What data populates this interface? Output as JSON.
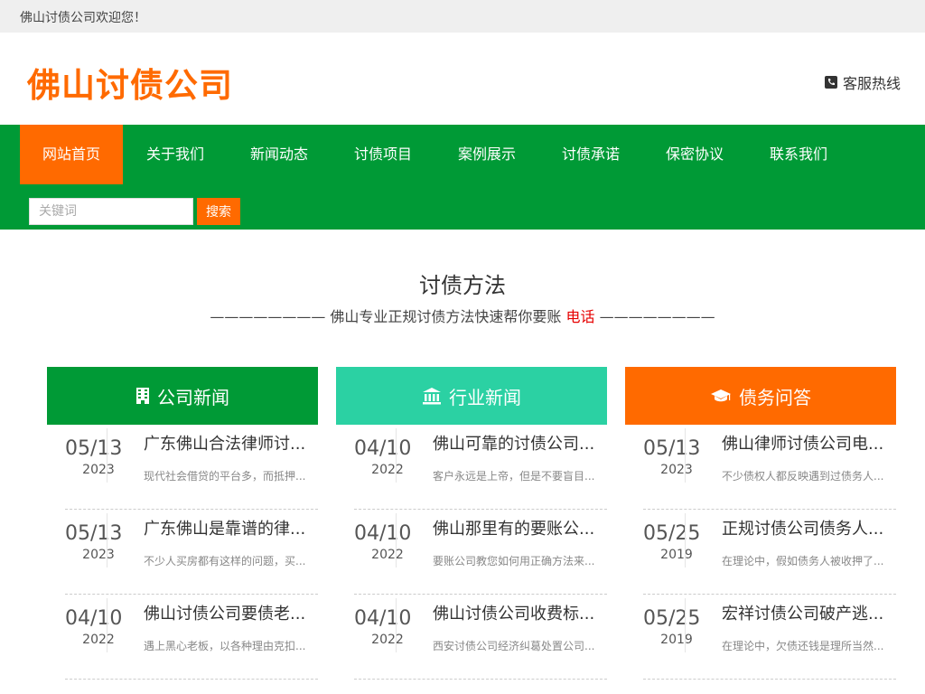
{
  "topbar": {
    "welcome": "佛山讨债公司欢迎您！"
  },
  "header": {
    "logo": "佛山讨债公司",
    "hotline": "客服热线"
  },
  "nav": {
    "items": [
      {
        "label": "网站首页"
      },
      {
        "label": "关于我们"
      },
      {
        "label": "新闻动态"
      },
      {
        "label": "讨债项目"
      },
      {
        "label": "案例展示"
      },
      {
        "label": "讨债承诺"
      },
      {
        "label": "保密协议"
      },
      {
        "label": "联系我们"
      }
    ],
    "search_placeholder": "关键词",
    "search_button": "搜索"
  },
  "section": {
    "title": "讨债方法",
    "subtitle_left": "———————— 佛山专业正规讨债方法快速帮你要账",
    "subtitle_phone": "电话",
    "subtitle_right": "————————"
  },
  "colors": {
    "green": "#009a36",
    "teal": "#2bd1a3",
    "orange": "#ff6a00"
  },
  "columns": [
    {
      "title": "公司新闻",
      "icon": "building-icon",
      "items": [
        {
          "md": "05/13",
          "year": "2023",
          "title": "广东佛山合法律师讨...",
          "desc": "现代社会借贷的平台多，而抵押..."
        },
        {
          "md": "05/13",
          "year": "2023",
          "title": "广东佛山是靠谱的律...",
          "desc": "不少人买房都有这样的问题，买..."
        },
        {
          "md": "04/10",
          "year": "2022",
          "title": "佛山讨债公司要债老...",
          "desc": "遇上黑心老板，以各种理由克扣..."
        }
      ]
    },
    {
      "title": "行业新闻",
      "icon": "bank-icon",
      "items": [
        {
          "md": "04/10",
          "year": "2022",
          "title": "佛山可靠的讨债公司...",
          "desc": "客户永远是上帝，但是不要盲目..."
        },
        {
          "md": "04/10",
          "year": "2022",
          "title": "佛山那里有的要账公...",
          "desc": "要账公司教您如何用正确方法来..."
        },
        {
          "md": "04/10",
          "year": "2022",
          "title": "佛山讨债公司收费标...",
          "desc": "西安讨债公司经济纠葛处置公司..."
        }
      ]
    },
    {
      "title": "债务问答",
      "icon": "graduation-cap-icon",
      "items": [
        {
          "md": "05/13",
          "year": "2023",
          "title": "佛山律师讨债公司电...",
          "desc": "不少债权人都反映遇到过债务人..."
        },
        {
          "md": "05/25",
          "year": "2019",
          "title": "正规讨债公司债务人...",
          "desc": "在理论中，假如债务人被收押了..."
        },
        {
          "md": "05/25",
          "year": "2019",
          "title": "宏祥讨债公司破产逃...",
          "desc": "在理论中，欠债还钱是理所当然..."
        }
      ]
    }
  ]
}
